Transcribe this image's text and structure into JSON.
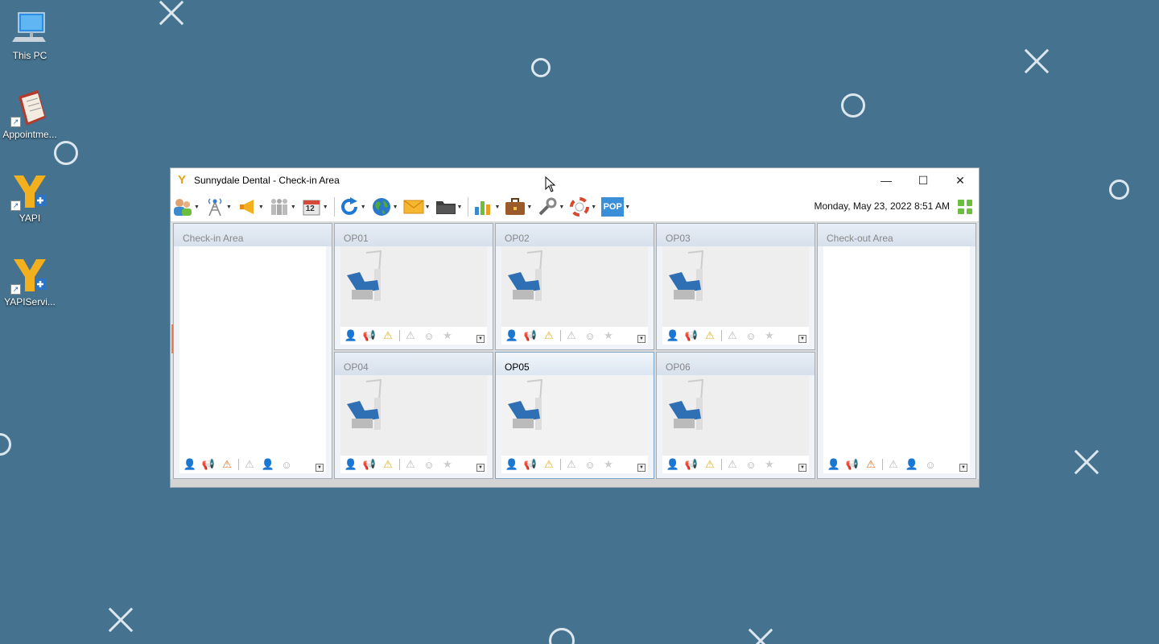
{
  "desktop": {
    "icons": [
      {
        "label": "This PC",
        "icon": "computer-icon"
      },
      {
        "label": "Appointme...",
        "icon": "book-icon"
      },
      {
        "label": "YAPI",
        "icon": "yapi-logo-icon"
      },
      {
        "label": "YAPIServi...",
        "icon": "yapi-logo-icon"
      }
    ]
  },
  "window": {
    "title": "Sunnydale Dental - Check-in Area",
    "minimize": "—",
    "maximize": "☐",
    "close": "✕",
    "datetime": "Monday, May 23, 2022 8:51 AM",
    "toolbar": [
      {
        "icon": "patients-icon"
      },
      {
        "icon": "antenna-icon"
      },
      {
        "icon": "megaphone-icon"
      },
      {
        "icon": "group-icon"
      },
      {
        "icon": "calendar-icon",
        "text": "12"
      },
      {
        "icon": "refresh-icon"
      },
      {
        "icon": "globe-icon"
      },
      {
        "icon": "mail-icon"
      },
      {
        "icon": "folder-icon"
      },
      {
        "icon": "chart-icon"
      },
      {
        "icon": "briefcase-icon"
      },
      {
        "icon": "tools-icon"
      },
      {
        "icon": "lifebuoy-icon"
      },
      {
        "icon": "pop-icon",
        "text": "POP"
      }
    ],
    "panels": {
      "checkin": "Check-in Area",
      "op01": "OP01",
      "op02": "OP02",
      "op03": "OP03",
      "op04": "OP04",
      "op05": "OP05",
      "op06": "OP06",
      "checkout": "Check-out Area"
    }
  },
  "colors": {
    "desktop_bg": "#44728f",
    "accent_orange": "#e87a4f",
    "pop_blue": "#3b8fd9"
  }
}
